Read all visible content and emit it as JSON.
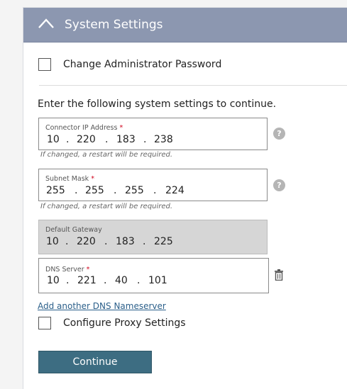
{
  "header": {
    "title": "System Settings",
    "collapse_icon": "chevron-up-icon"
  },
  "change_password": {
    "label": "Change Administrator Password",
    "checked": false
  },
  "intro_text": "Enter the following system settings to continue.",
  "connector_ip": {
    "label": "Connector IP Address",
    "required_mark": "*",
    "octets": [
      "10",
      "220",
      "183",
      "238"
    ],
    "hint": "If changed, a restart will be required."
  },
  "subnet_mask": {
    "label": "Subnet Mask",
    "required_mark": "*",
    "octets": [
      "255",
      "255",
      "255",
      "224"
    ],
    "hint": "If changed, a restart will be required."
  },
  "default_gateway": {
    "label": "Default Gateway",
    "octets": [
      "10",
      "220",
      "183",
      "225"
    ]
  },
  "dns_server": {
    "label": "DNS Server",
    "required_mark": "*",
    "octets": [
      "10",
      "221",
      "40",
      "101"
    ]
  },
  "add_dns_link": "Add another DNS Nameserver",
  "proxy": {
    "label": "Configure Proxy Settings",
    "checked": false
  },
  "continue_button": "Continue",
  "help_icon_glyph": "?",
  "dot": ".",
  "colors": {
    "header_bg": "#8c97b0",
    "button_bg": "#3d6d82",
    "link": "#2b5f8a",
    "required": "#d0021b",
    "disabled_field": "#d6d6d6"
  }
}
